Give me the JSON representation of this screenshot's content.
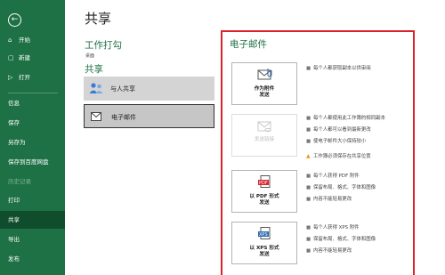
{
  "sidebar": {
    "back_icon": "←",
    "items": [
      {
        "label": "开始",
        "icon": "⌂"
      },
      {
        "label": "新建",
        "icon": "▢"
      },
      {
        "label": "打开",
        "icon": "▷"
      },
      {
        "label": "信息"
      },
      {
        "label": "保存"
      },
      {
        "label": "另存为"
      },
      {
        "label": "保存到百度网盘"
      },
      {
        "label": "历史记录"
      },
      {
        "label": "打印"
      },
      {
        "label": "共享"
      },
      {
        "label": "导出"
      },
      {
        "label": "发布"
      }
    ]
  },
  "page": {
    "title": "共享",
    "collab_title": "工作打勾",
    "collab_note": "桌面",
    "share_section_title": "共享",
    "options": [
      {
        "label": "与人共享",
        "icon": "people-icon"
      },
      {
        "label": "电子邮件",
        "icon": "mail-icon"
      }
    ]
  },
  "email": {
    "title": "电子邮件",
    "actions": [
      {
        "line1": "作为附件",
        "line2": "发送",
        "bullets": [
          "每个人都获取副本以供审阅"
        ]
      },
      {
        "line1": "发送链接",
        "line2": "",
        "disabled": true,
        "bullets": [
          "每个人都使用此工作簿的相同副本",
          "每个人都可以看到最新更改",
          "使电子邮件大小保持较小"
        ],
        "warning": "工作簿必须保存在共享位置"
      },
      {
        "line1": "以 PDF 形式",
        "line2": "发送",
        "bullets": [
          "每个人获得 PDF 附件",
          "保留布局、格式、字体和图像",
          "内容不能轻易更改"
        ]
      },
      {
        "line1": "以 XPS 形式",
        "line2": "发送",
        "bullets": [
          "每个人获得 XPS 附件",
          "保留布局、格式、字体和图像",
          "内容不能轻易更改"
        ]
      }
    ]
  },
  "colors": {
    "sidebar": "#1e7145",
    "active": "#104d2d",
    "highlight": "#d9232d"
  }
}
